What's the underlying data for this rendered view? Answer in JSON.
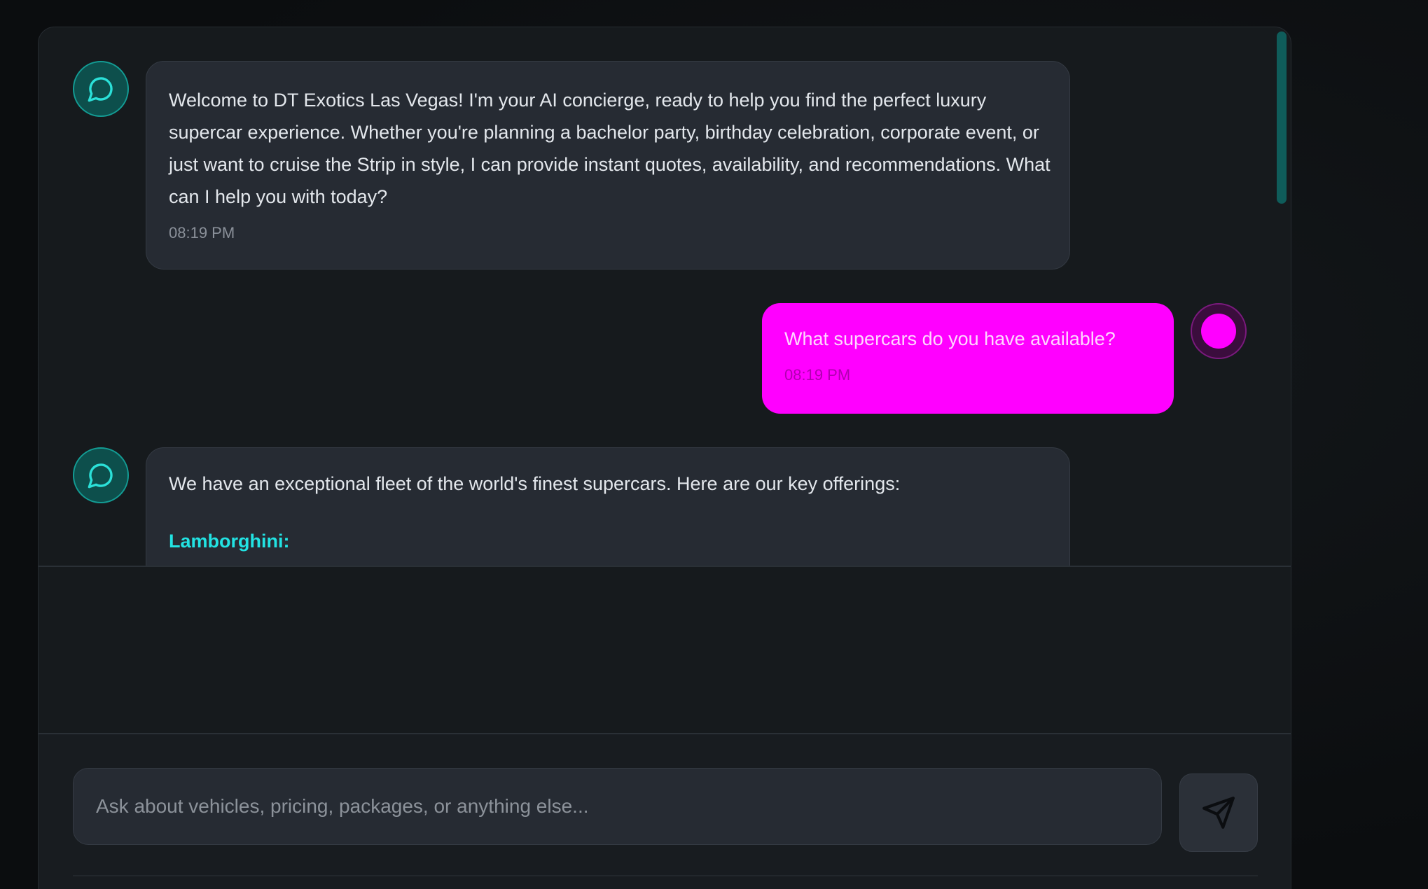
{
  "conversation": {
    "messages": [
      {
        "role": "assistant",
        "text": "Welcome to DT Exotics Las Vegas! I'm your AI concierge, ready to help you find the perfect luxury supercar experience. Whether you're planning a bachelor party, birthday celebration, corporate event, or just want to cruise the Strip in style, I can provide instant quotes, availability, and recommendations. What can I help you with today?",
        "time": "08:19 PM"
      },
      {
        "role": "user",
        "text": "What supercars do you have available?",
        "time": "08:19 PM"
      },
      {
        "role": "assistant",
        "text": "We have an exceptional fleet of the world's finest supercars. Here are our key offerings:",
        "heading": "Lamborghini:"
      }
    ]
  },
  "composer": {
    "placeholder": "Ask about vehicles, pricing, packages, or anything else..."
  },
  "icons": {
    "assistant_avatar": "chat-bubble-icon",
    "user_avatar": "user-dot-icon",
    "send": "send-icon"
  },
  "colors": {
    "accent_cyan": "#22e3e3",
    "user_bubble": "#ff00ff",
    "assistant_avatar": "#0d4f4c"
  }
}
